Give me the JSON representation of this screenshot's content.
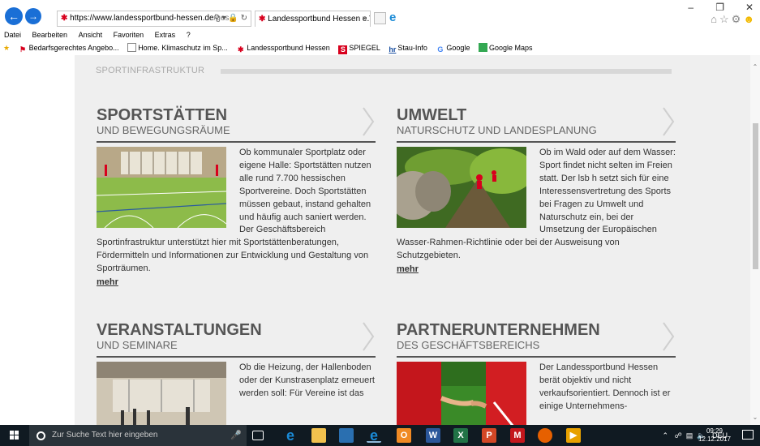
{
  "browser": {
    "url_host": "https://www.landessportbund-hessen.de",
    "url_rest": "/ges…",
    "tab_title": "Landessportbund Hessen e.V.",
    "menu": [
      "Datei",
      "Bearbeiten",
      "Ansicht",
      "Favoriten",
      "Extras",
      "?"
    ],
    "favorites": [
      {
        "label": "Bedarfsgerechtes Angebo...",
        "icon": "lsb-flag-icon"
      },
      {
        "label": "Home. Klimaschutz im Sp...",
        "icon": "page-icon"
      },
      {
        "label": "Landessportbund Hessen",
        "icon": "lsb-icon"
      },
      {
        "label": "SPIEGEL",
        "icon": "spiegel-icon"
      },
      {
        "label": "Stau-Info",
        "icon": "hr-icon"
      },
      {
        "label": "Google",
        "icon": "google-icon"
      },
      {
        "label": "Google Maps",
        "icon": "maps-icon"
      }
    ],
    "spiegel_icon_text": "S",
    "hr_icon_text": "hr",
    "google_icon_text": "G"
  },
  "page": {
    "section_label": "SPORTINFRASTRUKTUR",
    "cards": [
      {
        "title": "SPORTSTÄTTEN",
        "subtitle": "UND BEWEGUNGSRÄUME",
        "text": "Ob kommunaler Sportplatz oder eigene Halle: Sportstätten nutzen alle rund 7.700 hessischen Sportvereine. Doch Sportstätten müssen gebaut, instand gehalten und häufig auch saniert werden. Der Geschäftsbereich Sportinfrastruktur unterstützt hier mit Sportstättenberatungen, Fördermitteln und Informationen zur Entwicklung und Gestaltung von Sporträumen.",
        "more": "mehr"
      },
      {
        "title": "UMWELT",
        "subtitle": "NATURSCHUTZ UND LANDESPLANUNG",
        "text": "Ob im Wald oder auf dem Wasser: Sport findet nicht selten im Freien statt. Der lsb h setzt sich für eine Interessensvertretung des Sports bei Fragen zu Umwelt und Naturschutz ein, bei der Umsetzung der Europäischen Wasser-Rahmen-Richtlinie oder bei der Ausweisung von Schutzgebieten.",
        "more": "mehr"
      },
      {
        "title": "VERANSTALTUNGEN",
        "subtitle": "UND SEMINARE",
        "text": "Ob die Heizung, der Hallenboden oder der Kunstrasenplatz erneuert werden soll: Für Vereine ist das",
        "more": ""
      },
      {
        "title": "PARTNERUNTERNEHMEN",
        "subtitle": "DES GESCHÄFTSBEREICHS",
        "text": "Der Landessportbund Hessen berät objektiv und nicht verkaufsorientiert. Dennoch ist er einige Unternehmens-",
        "more": ""
      }
    ]
  },
  "taskbar": {
    "search_placeholder": "Zur Suche Text hier eingeben",
    "language": "DEU",
    "time": "09:29",
    "date": "12.12.2017"
  },
  "colors": {
    "accent_blue": "#1a6fd6",
    "lsb_red": "#d8001d",
    "heading_gray": "#555555",
    "panel_bg": "#efefef"
  }
}
